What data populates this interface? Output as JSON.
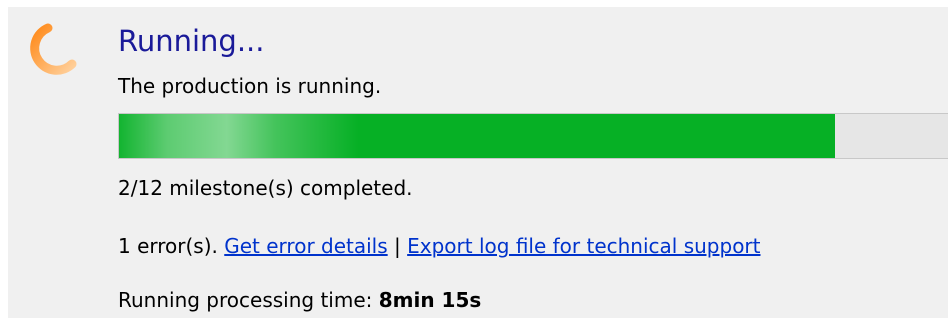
{
  "colors": {
    "title": "#1a1a99",
    "progress_fill": "#06b025",
    "progress_track": "#e6e6e6",
    "link": "#0033cc",
    "panel_background": "#f0f0f0",
    "spinner": "#ff9a2e"
  },
  "status": {
    "icon": "loading-spinner-icon",
    "title": "Running...",
    "message": "The production is running."
  },
  "progress": {
    "fraction": 0.853
  },
  "milestones": {
    "text": "2/12 milestone(s) completed."
  },
  "errors": {
    "count_text": "1 error(s).",
    "details_link": "Get error details",
    "separator": "|",
    "export_link": "Export log file for technical support"
  },
  "timing": {
    "label": "Running processing time:",
    "value": "8min 15s"
  }
}
